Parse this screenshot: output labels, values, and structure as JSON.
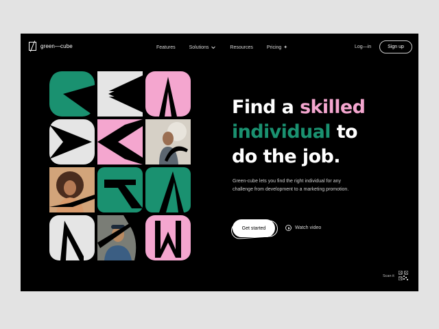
{
  "brand": {
    "name": "green—cube"
  },
  "nav": {
    "items": [
      {
        "label": "Features"
      },
      {
        "label": "Solutions"
      },
      {
        "label": "Resources"
      },
      {
        "label": "Pricing"
      }
    ],
    "pricing_badge": "✦",
    "login_label": "Log—in",
    "signup_label": "Sign up"
  },
  "hero": {
    "line1_a": "Find a ",
    "line1_b": "skilled",
    "line2_a": "individual",
    "line2_b": " to",
    "line3": "do the job.",
    "description": "Green-cube lets you find the right individual for any challenge from development to a marketing promotion.",
    "cta_primary": "Get started",
    "cta_secondary": "Watch video"
  },
  "footer": {
    "scan_label": "Scan it"
  },
  "colors": {
    "green": "#1a9170",
    "pink": "#f4a6cf",
    "light": "#e5e5e5",
    "bg": "#000000"
  },
  "icons": [
    "logo-icon",
    "chevron-down-icon",
    "sparkle-icon",
    "play-icon",
    "qr-code-icon"
  ]
}
